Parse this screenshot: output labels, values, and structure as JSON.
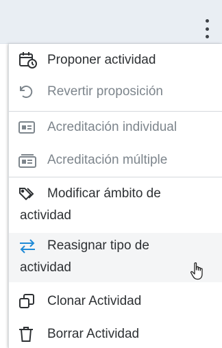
{
  "menu": {
    "items": [
      {
        "label": "Proponer actividad",
        "icon": "calendar-clock-icon",
        "enabled": true
      },
      {
        "label": "Revertir proposición",
        "icon": "undo-icon",
        "enabled": false
      },
      {
        "label": "Acreditación individual",
        "icon": "id-card-icon",
        "enabled": false
      },
      {
        "label": "Acreditación múltiple",
        "icon": "id-cards-icon",
        "enabled": false
      },
      {
        "label_line1": "Modificar ámbito de",
        "label_line2": "actividad",
        "icon": "tags-icon",
        "enabled": true
      },
      {
        "label_line1": "Reasignar tipo de",
        "label_line2": "actividad",
        "icon": "swap-arrows-icon",
        "enabled": true,
        "hovered": true
      },
      {
        "label": "Clonar Actividad",
        "icon": "clone-icon",
        "enabled": true
      },
      {
        "label": "Borrar Actividad",
        "icon": "trash-icon",
        "enabled": true
      }
    ]
  },
  "colors": {
    "text": "#2d3033",
    "text_disabled": "#7d858c",
    "accent_icon": "#1f8ad6",
    "topbar_bg": "#e9eef3",
    "hover_bg": "#f4f5f6"
  },
  "toolbar": {
    "kebab_icon": "more-vertical-icon"
  }
}
